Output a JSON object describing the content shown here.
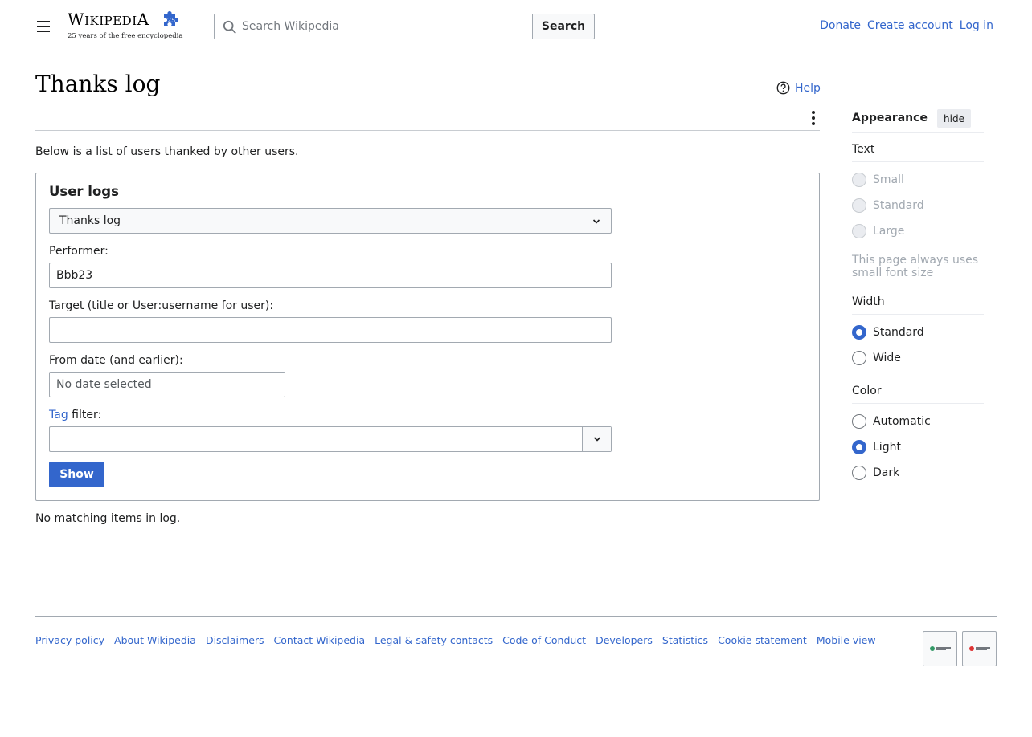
{
  "header": {
    "logo_wordmark": "Wikipedia",
    "logo_badge": "25",
    "logo_tagline": "25 years of the free encyclopedia",
    "search_placeholder": "Search Wikipedia",
    "search_button": "Search",
    "user_links": [
      "Donate",
      "Create account",
      "Log in"
    ]
  },
  "page": {
    "title": "Thanks log",
    "help_label": "Help",
    "intro": "Below is a list of users thanked by other users.",
    "no_items": "No matching items in log."
  },
  "form": {
    "legend": "User logs",
    "log_type_selected": "Thanks log",
    "performer_label": "Performer:",
    "performer_value": "Bbb23",
    "target_label": "Target (title or User:username for user):",
    "target_value": "",
    "from_date_label": "From date (and earlier):",
    "from_date_placeholder": "No date selected",
    "tag_link": "Tag",
    "tag_label_rest": " filter:",
    "tag_value": "",
    "show_button": "Show"
  },
  "appearance": {
    "title": "Appearance",
    "hide_button": "hide",
    "text_section": "Text",
    "text_options": [
      "Small",
      "Standard",
      "Large"
    ],
    "text_note": "This page always uses small font size",
    "width_section": "Width",
    "width_options": [
      "Standard",
      "Wide"
    ],
    "width_selected": "Standard",
    "color_section": "Color",
    "color_options": [
      "Automatic",
      "Light",
      "Dark"
    ],
    "color_selected": "Light"
  },
  "footer": {
    "links": [
      "Privacy policy",
      "About Wikipedia",
      "Disclaimers",
      "Contact Wikipedia",
      "Legal & safety contacts",
      "Code of Conduct",
      "Developers",
      "Statistics",
      "Cookie statement",
      "Mobile view"
    ],
    "badges": [
      "wikimedia-foundation-badge",
      "powered-by-mediawiki-badge"
    ]
  },
  "colors": {
    "link": "#3366cc",
    "primary_button": "#3366cc",
    "border": "#a2a9b1",
    "text": "#202122"
  }
}
